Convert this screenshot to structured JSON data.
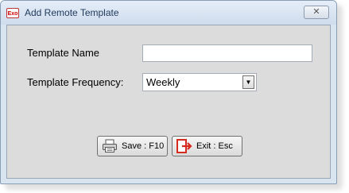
{
  "window": {
    "title": "Add Remote Template",
    "app_icon_text": "Exo",
    "close_glyph": "✕"
  },
  "form": {
    "template_name_label": "Template Name",
    "template_name_value": "",
    "frequency_label": "Template Frequency:",
    "frequency_selected": "Weekly"
  },
  "buttons": {
    "save_label": "Save : F10",
    "save_icon": "printer-icon",
    "exit_label": "Exit : Esc",
    "exit_icon": "exit-icon"
  },
  "colors": {
    "exit_icon": "#d62a1e"
  }
}
